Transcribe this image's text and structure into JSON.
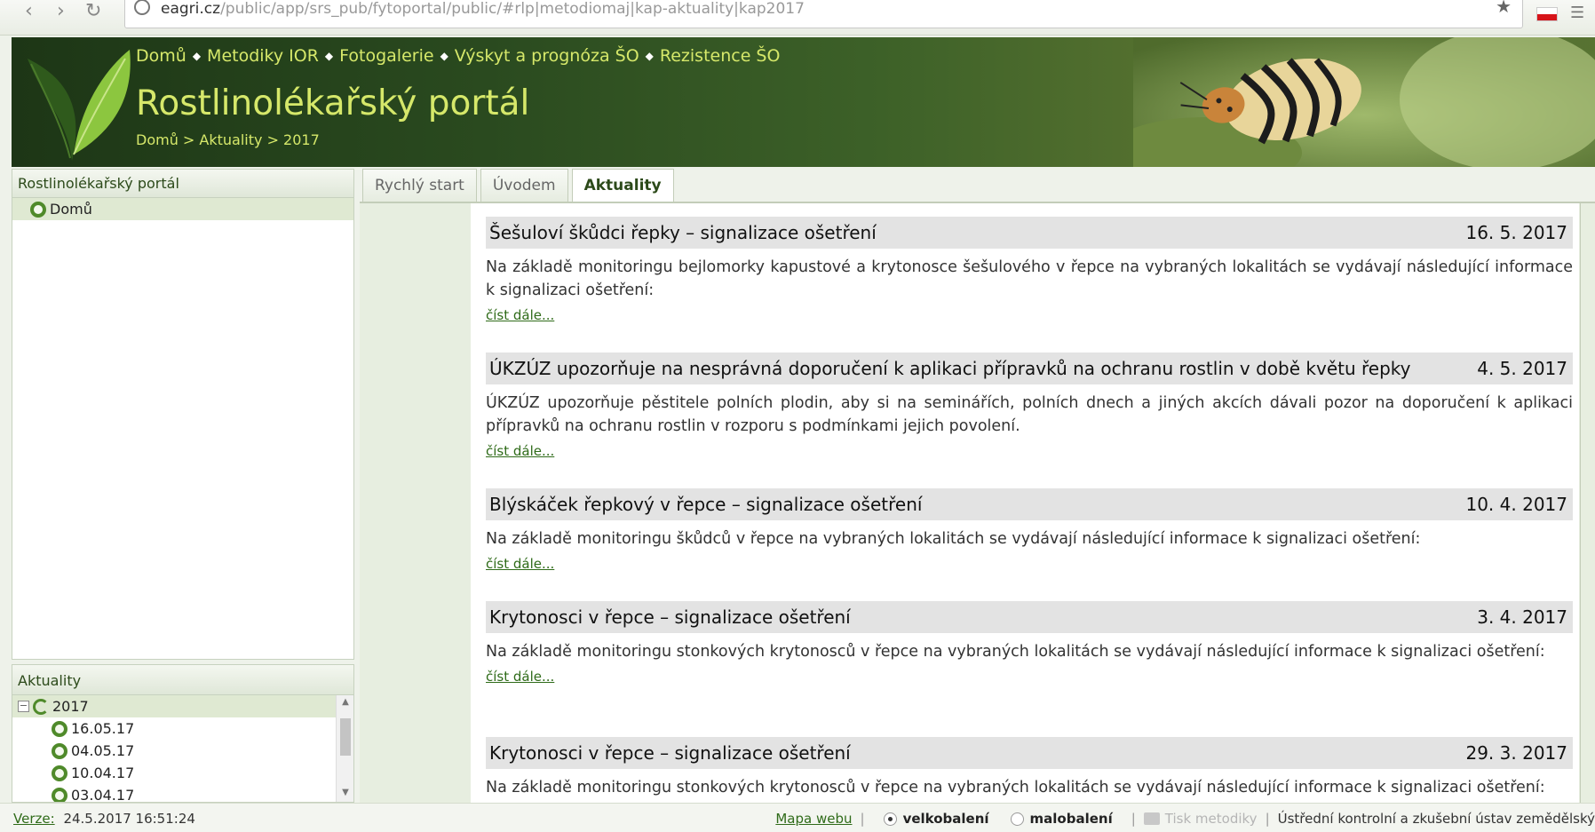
{
  "browser": {
    "url_host": "eagri.cz",
    "url_path": "/public/app/srs_pub/fytoportal/public/#rlp|metodiomaj|kap-aktuality|kap2017"
  },
  "header": {
    "nav": [
      "Domů",
      "Metodiky IOR",
      "Fotogalerie",
      "Výskyt a prognóza ŠO",
      "Rezistence ŠO"
    ],
    "title": "Rostlinolékařský portál",
    "breadcrumb": "Domů > Aktuality > 2017"
  },
  "left_tree": {
    "title": "Rostlinolékařský portál",
    "items": [
      {
        "label": "Domů"
      }
    ]
  },
  "aktuality_tree": {
    "title": "Aktuality",
    "year": "2017",
    "items": [
      "16.05.17",
      "04.05.17",
      "10.04.17",
      "03.04.17"
    ]
  },
  "tabs": [
    {
      "label": "Rychlý start",
      "active": false
    },
    {
      "label": "Úvodem",
      "active": false
    },
    {
      "label": "Aktuality",
      "active": true
    }
  ],
  "articles": [
    {
      "title": "Šešuloví škůdci řepky – signalizace ošetření",
      "date": "16. 5. 2017",
      "text": "Na základě monitoringu bejlomorky kapustové a krytonosce šešulového v řepce na vybraných lokalitách se vydávají následující informace k signalizaci ošetření:",
      "more": "číst dále..."
    },
    {
      "title": "ÚKZÚZ upozorňuje na nesprávná doporučení k aplikaci přípravků na ochranu rostlin v době květu řepky",
      "date": "4. 5. 2017",
      "text": "ÚKZÚZ upozorňuje pěstitele polních plodin, aby si na seminářích, polních dnech a jiných akcích dávali pozor na doporučení k aplikaci přípravků na ochranu rostlin v rozporu s podmínkami jejich povolení.",
      "more": "číst dále..."
    },
    {
      "title": "Blýskáček řepkový v řepce – signalizace ošetření",
      "date": "10. 4. 2017",
      "text": "Na základě monitoringu škůdců v řepce na vybraných lokalitách se vydávají následující informace k signalizaci ošetření:",
      "more": "číst dále..."
    },
    {
      "title": "Krytonosci v řepce – signalizace ošetření",
      "date": "3. 4. 2017",
      "text": "Na základě monitoringu stonkových krytonosců v řepce na vybraných lokalitách se vydávají následující informace k signalizaci ošetření:",
      "more": "číst dále..."
    },
    {
      "title": "Krytonosci v řepce – signalizace ošetření",
      "date": "29. 3. 2017",
      "text": "Na základě monitoringu stonkových krytonosců v řepce na vybraných lokalitách se vydávají následující informace k signalizaci ošetření:",
      "more": ""
    }
  ],
  "footer": {
    "version_label": "Verze:",
    "version_value": "24.5.2017 16:51:24",
    "sitemap": "Mapa webu",
    "opt1": "velkobalení",
    "opt2": "malobalení",
    "print": "Tisk metodiky",
    "org": "Ústřední kontrolní a zkušební ústav zemědělský"
  },
  "icons": {
    "logo": "leaf-logo-icon",
    "tree_node": "ring-icon",
    "print": "printer-icon"
  },
  "colors": {
    "accent_text": "#d6e86a",
    "header_dark": "#1d3616",
    "link": "#2f6b19"
  }
}
